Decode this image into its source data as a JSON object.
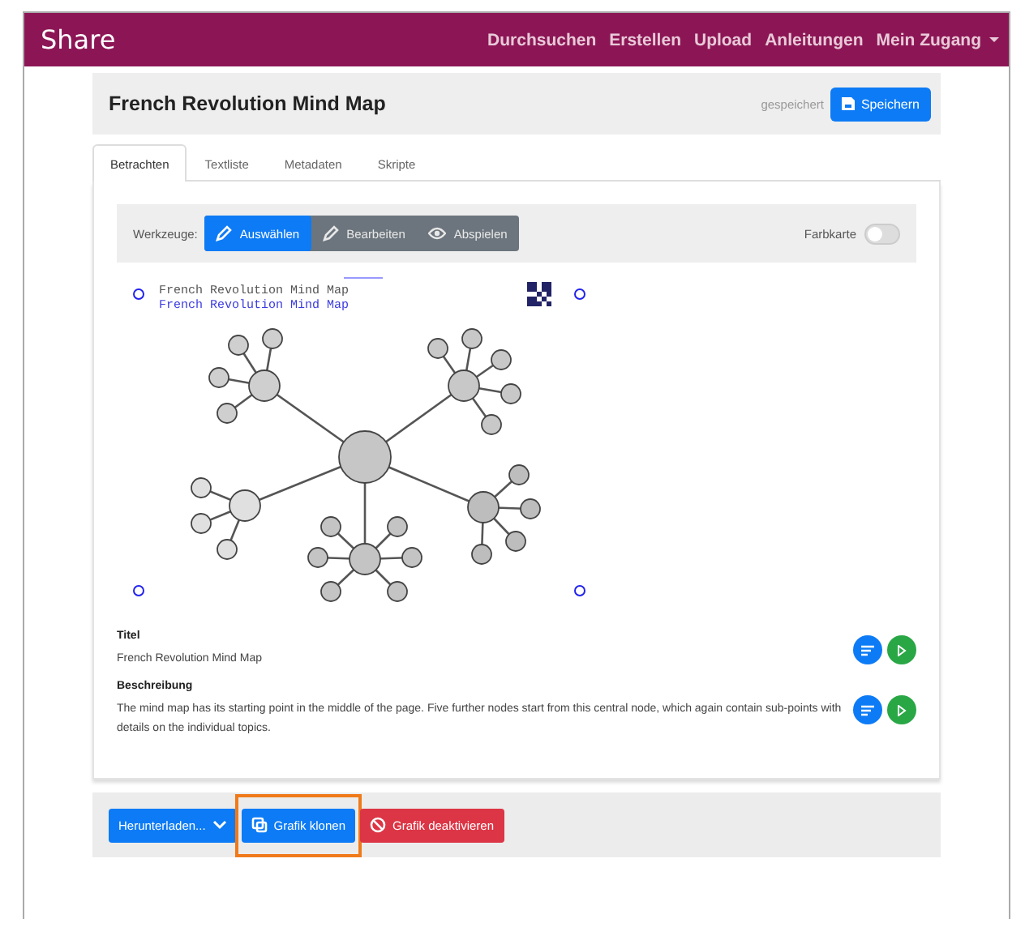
{
  "navbar": {
    "brand": "Share",
    "items": [
      {
        "label": "Durchsuchen",
        "dropdown": false
      },
      {
        "label": "Erstellen",
        "dropdown": false
      },
      {
        "label": "Upload",
        "dropdown": false
      },
      {
        "label": "Anleitungen",
        "dropdown": false
      },
      {
        "label": "Mein Zugang",
        "dropdown": true
      }
    ]
  },
  "header": {
    "title": "French Revolution Mind Map",
    "status": "gespeichert",
    "save_button": "Speichern"
  },
  "tabs": [
    {
      "label": "Betrachten",
      "selected": true
    },
    {
      "label": "Textliste",
      "selected": false
    },
    {
      "label": "Metadaten",
      "selected": false
    },
    {
      "label": "Skripte",
      "selected": false
    }
  ],
  "toolbar": {
    "label": "Werkzeuge:",
    "tools": [
      {
        "label": "Auswählen",
        "kind": "pencil",
        "selected": true
      },
      {
        "label": "Bearbeiten",
        "kind": "pencil",
        "selected": false
      },
      {
        "label": "Abspielen",
        "kind": "eye",
        "selected": false
      }
    ],
    "toggle": {
      "label": "Farbkarte",
      "on": false
    }
  },
  "canvas": {
    "lines": [
      {
        "text": "French Revolution Mind Map",
        "kind": "plain"
      },
      {
        "text": "French Revolution Mind Map",
        "kind": "link"
      }
    ]
  },
  "fields": [
    {
      "label": "Titel",
      "value": "French Revolution Mind Map"
    },
    {
      "label": "Beschreibung",
      "value": "The mind map has its starting point in the middle of the page. Five further nodes start from this central node, which again contain sub-points with details on the individual topics."
    }
  ],
  "actions": [
    {
      "label": "Herunterladen...",
      "kind": "download",
      "highlighted": false
    },
    {
      "label": "Grafik klonen",
      "kind": "clone",
      "highlighted": true
    },
    {
      "label": "Grafik deaktivieren",
      "kind": "disable",
      "highlighted": false
    }
  ]
}
